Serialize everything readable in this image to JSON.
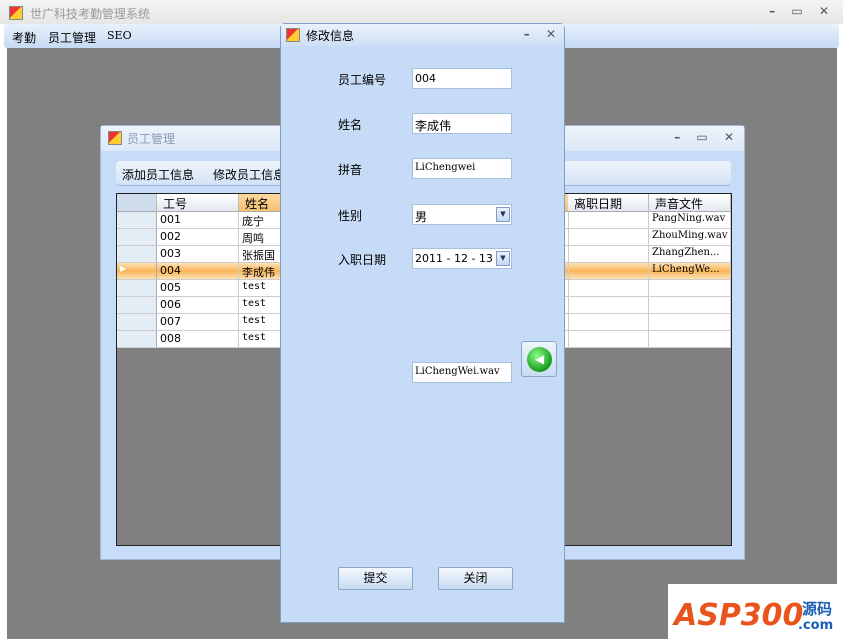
{
  "main_window": {
    "title": "世广科技考勤管理系统",
    "menu": [
      "考勤",
      "员工管理",
      "SEO"
    ]
  },
  "child_window": {
    "title": "员工管理",
    "toolbar": [
      "添加员工信息",
      "修改员工信息"
    ],
    "columns": [
      "工号",
      "姓名",
      "离职日期",
      "声音文件"
    ],
    "rows": [
      {
        "id": "001",
        "name": "庞宁",
        "leave": "",
        "sound": "PangNing.wav"
      },
      {
        "id": "002",
        "name": "周鸣",
        "leave": "",
        "sound": "ZhouMing.wav"
      },
      {
        "id": "003",
        "name": "张振国",
        "leave": "",
        "sound": "ZhangZhen..."
      },
      {
        "id": "004",
        "name": "李成伟",
        "leave": "",
        "sound": "LiChengWe..."
      },
      {
        "id": "005",
        "name": "test",
        "leave": "",
        "sound": ""
      },
      {
        "id": "006",
        "name": "test",
        "leave": "",
        "sound": ""
      },
      {
        "id": "007",
        "name": "test",
        "leave": "",
        "sound": ""
      },
      {
        "id": "008",
        "name": "test",
        "leave": "",
        "sound": ""
      }
    ],
    "selected_row": 3
  },
  "dialog": {
    "title": "修改信息",
    "labels": {
      "id": "员工编号",
      "name": "姓名",
      "pinyin": "拼音",
      "gender": "性别",
      "date": "入职日期"
    },
    "values": {
      "id": "004",
      "name": "李成伟",
      "pinyin": "LiChengwei",
      "gender": "男",
      "date": "2011 - 12 - 13",
      "sound": "LiChengWei.wav"
    },
    "submit": "提交",
    "close": "关闭"
  },
  "watermark": {
    "text": "ASP300",
    "sub": "源码",
    ".com": ".com"
  }
}
